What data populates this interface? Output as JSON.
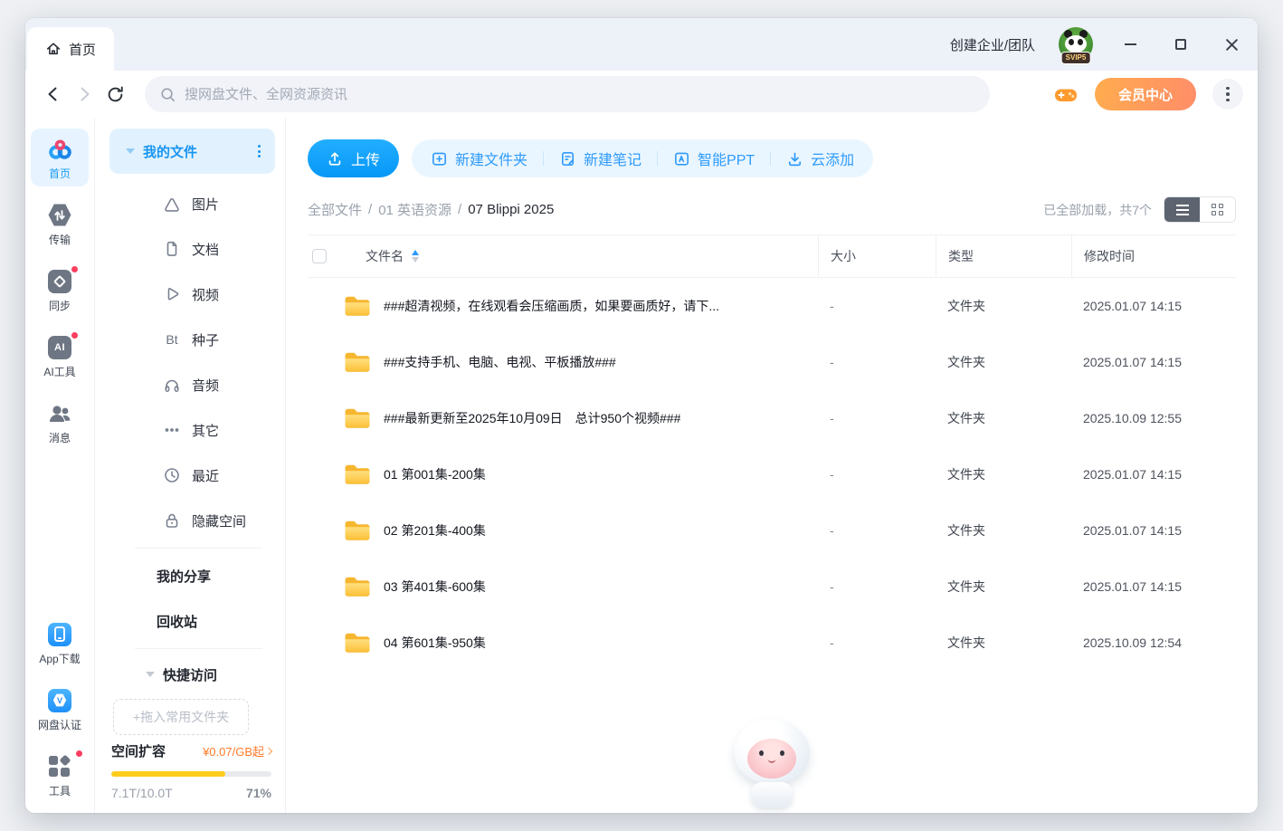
{
  "titlebar": {
    "tab_label": "首页",
    "create_team_label": "创建企业/团队",
    "avatar_badge": "SVIP5"
  },
  "browser_bar": {
    "search_placeholder": "搜网盘文件、全网资源资讯",
    "vip_center_label": "会员中心"
  },
  "rail": {
    "items": [
      {
        "label": "首页",
        "active": true
      },
      {
        "label": "传输"
      },
      {
        "label": "同步",
        "badge": true
      },
      {
        "label": "AI工具",
        "icon_text": "AI",
        "badge": true
      },
      {
        "label": "消息"
      },
      {
        "label": "App下载"
      },
      {
        "label": "网盘认证",
        "icon_text": "V"
      },
      {
        "label": "工具",
        "badge": true
      }
    ]
  },
  "sidebar": {
    "my_files_label": "我的文件",
    "categories": [
      {
        "label": "图片"
      },
      {
        "label": "文档"
      },
      {
        "label": "视频"
      },
      {
        "label": "种子",
        "icon_text": "Bt"
      },
      {
        "label": "音频"
      },
      {
        "label": "其它"
      },
      {
        "label": "最近"
      },
      {
        "label": "隐藏空间"
      }
    ],
    "my_share_label": "我的分享",
    "recycle_label": "回收站",
    "quick_access_label": "快捷访问",
    "drop_zone_hint": "+拖入常用文件夹",
    "storage": {
      "expand_label": "空间扩容",
      "price_label": "¥0.07/GB起",
      "usage": "7.1T/10.0T",
      "percent_label": "71%",
      "percent": 71
    }
  },
  "toolbar": {
    "upload_label": "上传",
    "actions": [
      {
        "label": "新建文件夹"
      },
      {
        "label": "新建笔记"
      },
      {
        "label": "智能PPT"
      },
      {
        "label": "云添加"
      }
    ]
  },
  "breadcrumb": {
    "separator": "/",
    "items": [
      {
        "label": "全部文件"
      },
      {
        "label": "01 英语资源"
      },
      {
        "label": "07 Blippi 2025"
      }
    ]
  },
  "status": {
    "loaded_label": "已全部加载，共7个"
  },
  "table": {
    "headers": {
      "name": "文件名",
      "size": "大小",
      "type": "类型",
      "modified": "修改时间"
    },
    "rows": [
      {
        "name": "###超清视频，在线观看会压缩画质，如果要画质好，请下...",
        "size": "-",
        "type": "文件夹",
        "modified": "2025.01.07 14:15"
      },
      {
        "name": "###支持手机、电脑、电视、平板播放###",
        "size": "-",
        "type": "文件夹",
        "modified": "2025.01.07 14:15"
      },
      {
        "name": "###最新更新至2025年10月09日　总计950个视频###",
        "size": "-",
        "type": "文件夹",
        "modified": "2025.10.09 12:55"
      },
      {
        "name": "01 第001集-200集",
        "size": "-",
        "type": "文件夹",
        "modified": "2025.01.07 14:15"
      },
      {
        "name": "02 第201集-400集",
        "size": "-",
        "type": "文件夹",
        "modified": "2025.01.07 14:15"
      },
      {
        "name": "03 第401集-600集",
        "size": "-",
        "type": "文件夹",
        "modified": "2025.01.07 14:15"
      },
      {
        "name": "04 第601集-950集",
        "size": "-",
        "type": "文件夹",
        "modified": "2025.10.09 12:54"
      }
    ]
  }
}
